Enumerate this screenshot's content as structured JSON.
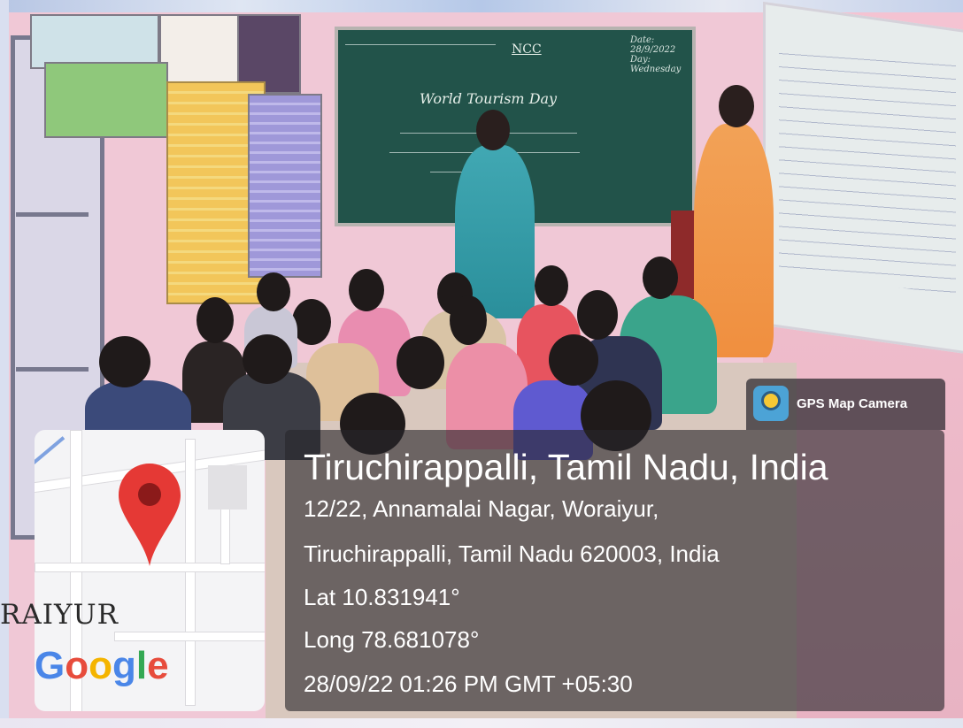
{
  "badge": {
    "icon": "gps-map-camera-icon",
    "label": "GPS Map Camera"
  },
  "location": {
    "title": "Tiruchirappalli, Tamil Nadu, India",
    "address_line1": "12/22, Annamalai Nagar, Woraiyur,",
    "address_line2": "Tiruchirappalli, Tamil Nadu 620003, India",
    "latitude": "Lat 10.831941°",
    "longitude": "Long 78.681078°",
    "timestamp": "28/09/22 01:26 PM GMT +05:30"
  },
  "map": {
    "area_label": "RAIYUR",
    "logo": [
      "G",
      "o",
      "o",
      "g",
      "l",
      "e"
    ],
    "pin_icon": "map-pin-icon",
    "colors": {
      "pin": "#e53935",
      "pin_center": "#8b1a1a"
    }
  },
  "blackboard": {
    "heading": "World Tourism Day",
    "tag": "NCC",
    "date": "Date: 28/9/2022",
    "day": "Day: Wednesday"
  }
}
